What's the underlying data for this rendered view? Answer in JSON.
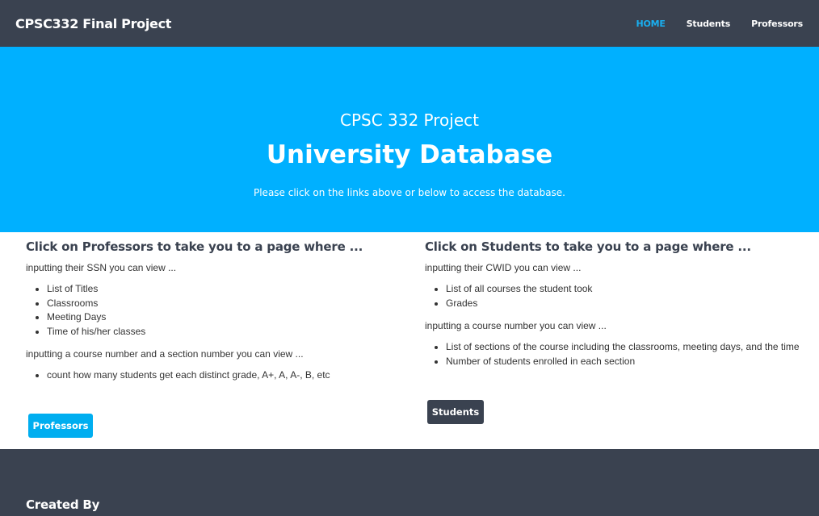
{
  "navbar": {
    "brand": "CPSC332 Final Project",
    "links": [
      {
        "label": "HOME",
        "active": true
      },
      {
        "label": "Students",
        "active": false
      },
      {
        "label": "Professors",
        "active": false
      }
    ]
  },
  "hero": {
    "pre_title": "CPSC 332 Project",
    "title": "University Database",
    "subtitle": "Please click on the links above or below to access the database."
  },
  "professors_section": {
    "heading": "Click on Professors to take you to a page where ...",
    "intro1": "inputting their SSN you can view ...",
    "list1": [
      "List of Titles",
      "Classrooms",
      "Meeting Days",
      "Time of his/her classes"
    ],
    "intro2": "inputting a course number and a section number you can view ...",
    "list2": [
      "count how many students get each distinct grade, A+, A, A-, B, etc"
    ],
    "button": "Professors"
  },
  "students_section": {
    "heading": "Click on Students to take you to a page where ...",
    "intro1": "inputting their CWID you can view ...",
    "list1": [
      "List of all courses the student took",
      "Grades"
    ],
    "intro2": "inputting a course number you can view ...",
    "list2": [
      "List of sections of the course including the classrooms, meeting days, and the time",
      "Number of students enrolled in each section"
    ],
    "button": "Students"
  },
  "footer": {
    "heading": "Created By"
  },
  "colors": {
    "nav_bg": "#3a4250",
    "accent": "#00b0ff",
    "active_link": "#19aff0"
  }
}
